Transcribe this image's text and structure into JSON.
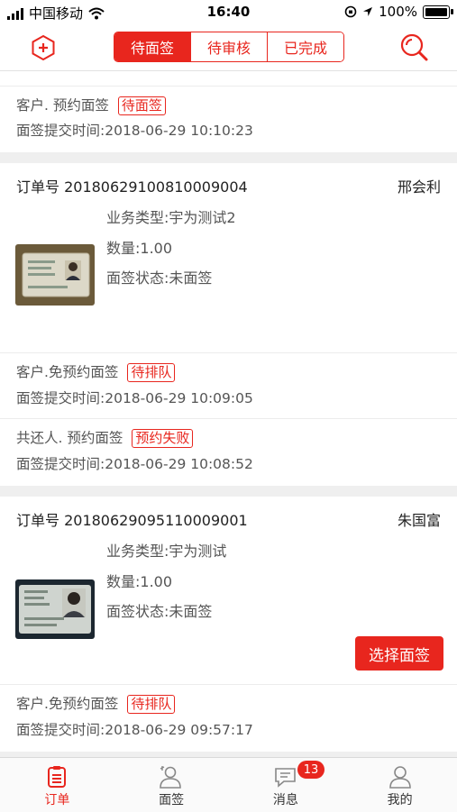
{
  "status_bar": {
    "carrier": "中国移动",
    "time": "16:40",
    "battery": "100%"
  },
  "header": {
    "segments": [
      {
        "label": "待面签",
        "active": true
      },
      {
        "label": "待审核",
        "active": false
      },
      {
        "label": "已完成",
        "active": false
      }
    ]
  },
  "top_partial": {
    "type_label": "客户. 预约面签",
    "badge": "待面签",
    "time_line": "面签提交时间:2018-06-29 10:10:23"
  },
  "orders": [
    {
      "order_no": "订单号 20180629100810009004",
      "customer": "邢会利",
      "business_type": "业务类型:宇为测试2",
      "quantity": "数量:1.00",
      "sign_status": "面签状态:未面签",
      "entries": [
        {
          "type_label": "客户.免预约面签",
          "badge": "待排队",
          "time_line": "面签提交时间:2018-06-29 10:09:05"
        },
        {
          "type_label": "共还人. 预约面签",
          "badge": "预约失败",
          "time_line": "面签提交时间:2018-06-29 10:08:52"
        }
      ]
    },
    {
      "order_no": "订单号 20180629095110009001",
      "customer": "朱国富",
      "business_type": "业务类型:宇为测试",
      "quantity": "数量:1.00",
      "sign_status": "面签状态:未面签",
      "action_button": "选择面签",
      "entries": [
        {
          "type_label": "客户.免预约面签",
          "badge": "待排队",
          "time_line": "面签提交时间:2018-06-29 09:57:17"
        }
      ]
    }
  ],
  "tabbar": {
    "items": [
      {
        "label": "订单",
        "icon": "order-icon",
        "active": true
      },
      {
        "label": "面签",
        "icon": "person-sign-icon",
        "active": false
      },
      {
        "label": "消息",
        "icon": "chat-icon",
        "active": false,
        "badge": "13"
      },
      {
        "label": "我的",
        "icon": "user-icon",
        "active": false
      }
    ]
  },
  "colors": {
    "accent": "#e8261e",
    "background": "#efefef"
  }
}
